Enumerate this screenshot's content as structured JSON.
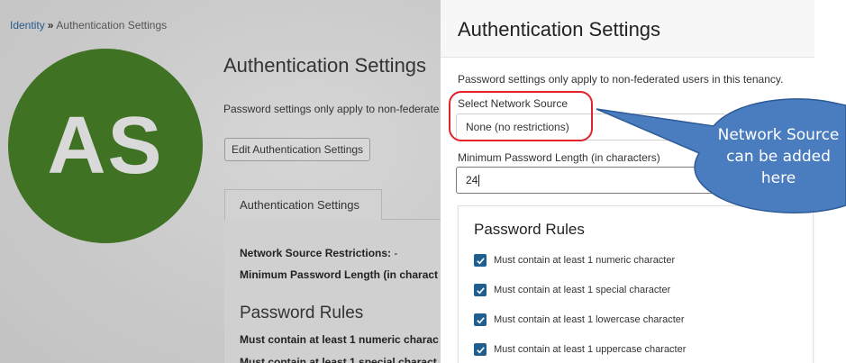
{
  "background": {
    "breadcrumb": {
      "parent": "Identity",
      "separator": "»",
      "current": "Authentication Settings"
    },
    "avatar_initials": "AS",
    "avatar_color": "#3f7222",
    "title": "Authentication Settings",
    "description": "Password settings only apply to non-federate",
    "edit_button": "Edit Authentication Settings",
    "tab_label": "Authentication Settings",
    "network_label": "Network Source Restrictions:",
    "network_value": "-",
    "min_length_label": "Minimum Password Length (in charact",
    "rules_title": "Password Rules",
    "rule_1": "Must contain at least 1 numeric charac",
    "rule_2": "Must contain at least 1 special charact"
  },
  "panel": {
    "title": "Authentication Settings",
    "description": "Password settings only apply to non-federated users in this tenancy.",
    "network_source": {
      "label": "Select Network Source",
      "value": "None (no restrictions)"
    },
    "min_length": {
      "label": "Minimum Password Length (in characters)",
      "value": "24"
    },
    "rules": {
      "title": "Password Rules",
      "items": [
        {
          "label": "Must contain at least 1 numeric character",
          "checked": true
        },
        {
          "label": "Must contain at least 1 special character",
          "checked": true
        },
        {
          "label": "Must contain at least 1 lowercase character",
          "checked": true
        },
        {
          "label": "Must contain at least 1 uppercase character",
          "checked": true
        }
      ]
    },
    "checkbox_color": "#1f5e8f"
  },
  "annotation": {
    "callout_lines": [
      "Network Source",
      "can be added",
      "here"
    ],
    "callout_fill": "#4a7cc0",
    "ring_color": "#e2232a"
  }
}
